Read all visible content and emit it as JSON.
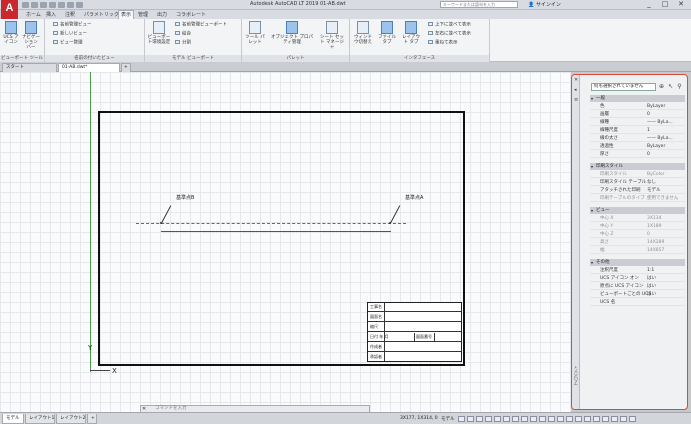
{
  "app": {
    "logo": "A",
    "title": "Autodesk AutoCAD LT 2019   01-AB.dwt",
    "search_placeholder": "キーワードまたは語句を入力",
    "signin": "サインイン",
    "window_minimize": "_",
    "window_restore": "□",
    "window_close": "✕"
  },
  "ribbon_tabs": [
    "ホーム",
    "挿入",
    "注釈",
    "パラメトリック",
    "表示",
    "管理",
    "出力",
    "コラボレート"
  ],
  "ribbon_active_tab": "表示",
  "ribbon": {
    "viewport_tools": {
      "title": "ビューポート ツール",
      "buttons": [
        "UCS アイコン",
        "ナビゲーション バー"
      ]
    },
    "named_views": {
      "title": "名前の付いたビュー",
      "items": [
        "名前管理ビュー",
        "新しいビュー",
        "ビュー管理"
      ]
    },
    "model_viewports": {
      "title": "モデル ビューポート",
      "button": "ビューポート環境設定",
      "items": [
        "名前管理ビューポート",
        "結合",
        "分割",
        "復元"
      ]
    },
    "palettes": {
      "title": "パレット",
      "buttons": [
        "ツール パレット",
        "オブジェクト プロパティ管理",
        "シート セット マネージャ"
      ]
    },
    "interface": {
      "title": "インタフェース",
      "buttons": [
        "ウィンドウ切替え",
        "ファイル タブ",
        "レイアウト タブ"
      ],
      "items": [
        "上下に並べて表示",
        "左右に並べて表示",
        "重ねて表示"
      ]
    }
  },
  "doc_tabs": [
    "スタート",
    "01-AB.dwt*",
    "+"
  ],
  "drawing": {
    "label_b": "基準点B",
    "label_a": "基準点A",
    "axis_y": "Y",
    "axis_x": "X",
    "titleblock": [
      "工事名",
      "図面名",
      "縮尺",
      "日付",
      "作成者",
      "承認者"
    ],
    "titleblock_mid": "図面番号",
    "titleblock_date_val": "年 月"
  },
  "command_line": {
    "placeholder": "コマンドを入力"
  },
  "properties": {
    "selection": "何も選択されていません",
    "sections": [
      {
        "title": "一般",
        "rows": [
          {
            "k": "色",
            "v": "ByLayer",
            "dim": false
          },
          {
            "k": "画層",
            "v": "0",
            "dim": false
          },
          {
            "k": "線種",
            "v": "—— ByLa...",
            "dim": false
          },
          {
            "k": "線種尺度",
            "v": "1",
            "dim": false
          },
          {
            "k": "線の太さ",
            "v": "—— ByLa...",
            "dim": false
          },
          {
            "k": "透過性",
            "v": "ByLayer",
            "dim": false
          },
          {
            "k": "厚さ",
            "v": "0",
            "dim": false
          }
        ]
      },
      {
        "title": "印刷スタイル",
        "rows": [
          {
            "k": "印刷スタイル",
            "v": "ByColor",
            "dim": true
          },
          {
            "k": "印刷スタイル テーブル",
            "v": "なし",
            "dim": false
          },
          {
            "k": "アタッチされた印刷",
            "v": "モデル",
            "dim": false
          },
          {
            "k": "印刷テーブルのタイプ",
            "v": "使用できません",
            "dim": true
          }
        ]
      },
      {
        "title": "ビュー",
        "rows": [
          {
            "k": "中心 X",
            "v": "3X134",
            "dim": true
          },
          {
            "k": "中心 Y",
            "v": "1X189",
            "dim": true
          },
          {
            "k": "中心 Z",
            "v": "0",
            "dim": true
          },
          {
            "k": "高さ",
            "v": "14X289",
            "dim": true
          },
          {
            "k": "幅",
            "v": "14X857",
            "dim": true
          }
        ]
      },
      {
        "title": "その他",
        "rows": [
          {
            "k": "注釈尺度",
            "v": "1:1",
            "dim": false
          },
          {
            "k": "UCS アイコン オン",
            "v": "はい",
            "dim": false
          },
          {
            "k": "原点に UCS アイコン",
            "v": "はい",
            "dim": false
          },
          {
            "k": "ビューポートごとの UCS",
            "v": "はい",
            "dim": false
          },
          {
            "k": "UCS 名",
            "v": "",
            "dim": false
          }
        ]
      }
    ],
    "strip_label": "プロパティ"
  },
  "status": {
    "tabs": [
      "モデル",
      "レイアウト1",
      "レイアウト2",
      "+"
    ],
    "coords": "3X177, 1X314, 0",
    "model_label": "モデル"
  }
}
